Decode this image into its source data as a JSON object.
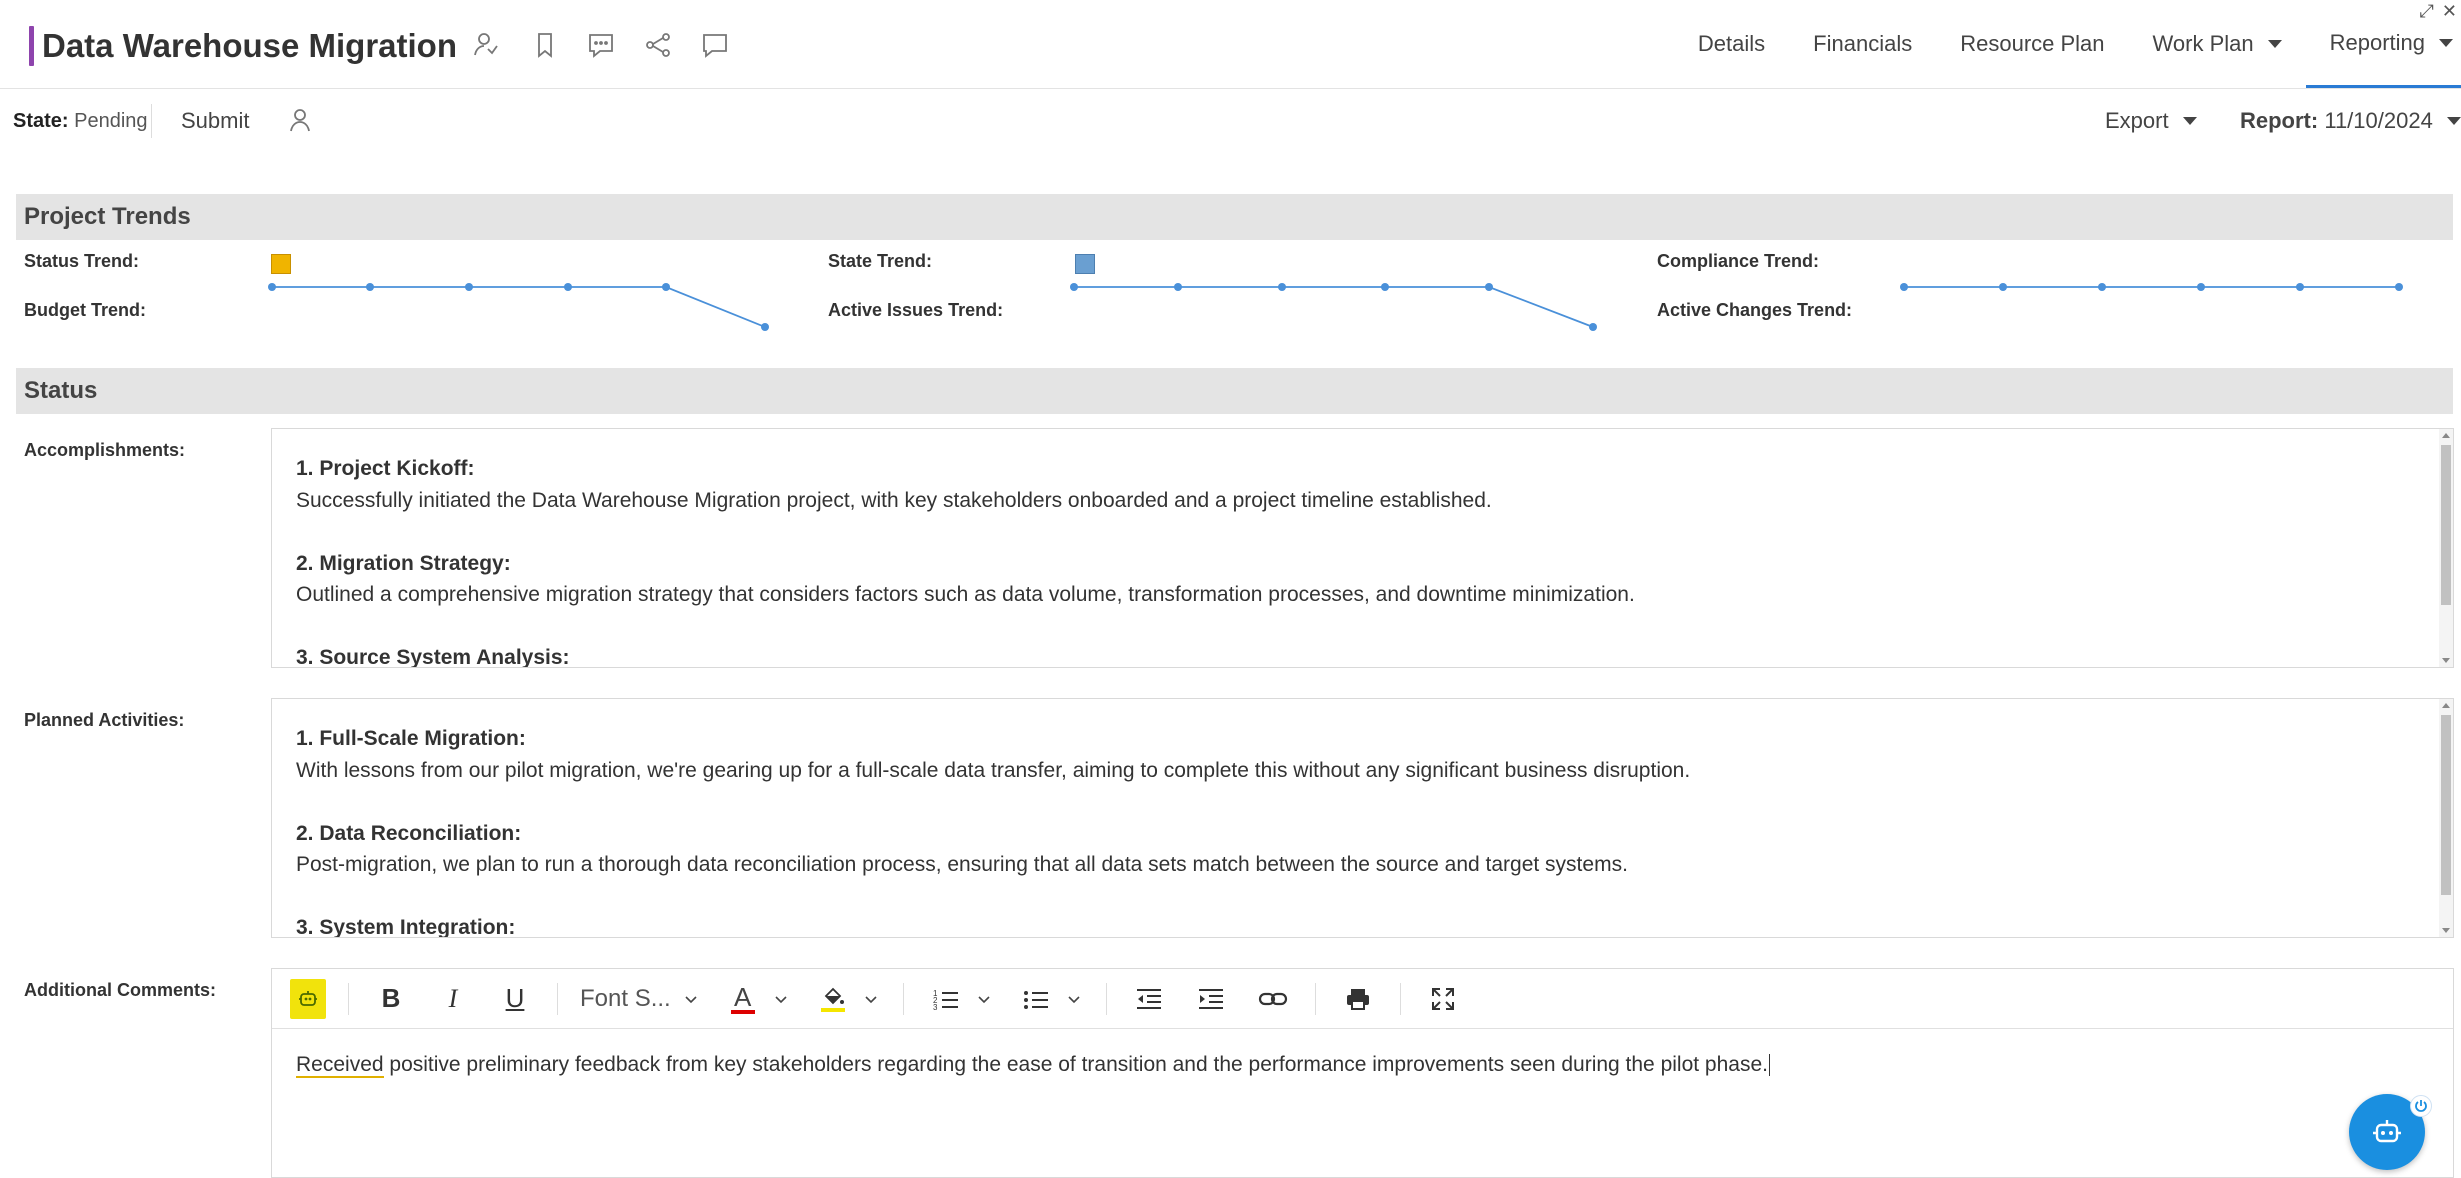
{
  "window": {
    "restore_icon": "restore-window-icon",
    "close_icon": "close-icon"
  },
  "header": {
    "title": "Data Warehouse Migration",
    "accent_color": "#8e44ad",
    "icons": [
      "person-arrow-icon",
      "bookmark-icon",
      "comment-icon",
      "share-icon",
      "chat-icon"
    ],
    "tabs": [
      {
        "label": "Details",
        "has_menu": false,
        "active": false
      },
      {
        "label": "Financials",
        "has_menu": false,
        "active": false
      },
      {
        "label": "Resource Plan",
        "has_menu": false,
        "active": false
      },
      {
        "label": "Work Plan",
        "has_menu": true,
        "active": false
      },
      {
        "label": "Reporting",
        "has_menu": true,
        "active": true
      }
    ]
  },
  "statebar": {
    "state_label": "State:",
    "state_value": "Pending",
    "submit_label": "Submit",
    "export_label": "Export",
    "report_label": "Report:",
    "report_value": "11/10/2024"
  },
  "trends": {
    "section_title": "Project Trends",
    "labels": {
      "status": "Status Trend:",
      "budget": "Budget Trend:",
      "state": "State Trend:",
      "active_issues": "Active Issues Trend:",
      "compliance": "Compliance Trend:",
      "active_changes": "Active Changes Trend:"
    },
    "status_color": "#f0b400",
    "state_color": "#6a9fd1",
    "line_color": "#4a90d9"
  },
  "status": {
    "section_title": "Status",
    "accomplishments": {
      "label": "Accomplishments:",
      "items": [
        {
          "heading": "1. Project Kickoff:",
          "text": "Successfully initiated the Data Warehouse Migration project, with key stakeholders onboarded and a project timeline established."
        },
        {
          "heading": "2. Migration Strategy:",
          "text": "Outlined a comprehensive migration strategy that considers factors such as data volume, transformation processes, and downtime minimization."
        },
        {
          "heading": "3. Source System Analysis:",
          "text": ""
        }
      ]
    },
    "planned": {
      "label": "Planned Activities:",
      "items": [
        {
          "heading": "1. Full-Scale Migration:",
          "text": "With lessons from our pilot migration, we're gearing up for a full-scale data transfer, aiming to complete this without any significant business disruption."
        },
        {
          "heading": "2. Data Reconciliation:",
          "text": "Post-migration, we plan to run a thorough data reconciliation process, ensuring that all data sets match between the source and target systems."
        },
        {
          "heading": "3. System Integration:",
          "text": ""
        }
      ]
    },
    "comments": {
      "label": "Additional Comments:",
      "font_placeholder": "Font S...",
      "text_first_word": "Received",
      "text_rest": " positive preliminary feedback from key stakeholders regarding the ease of transition and the performance improvements seen during the pilot phase."
    }
  }
}
